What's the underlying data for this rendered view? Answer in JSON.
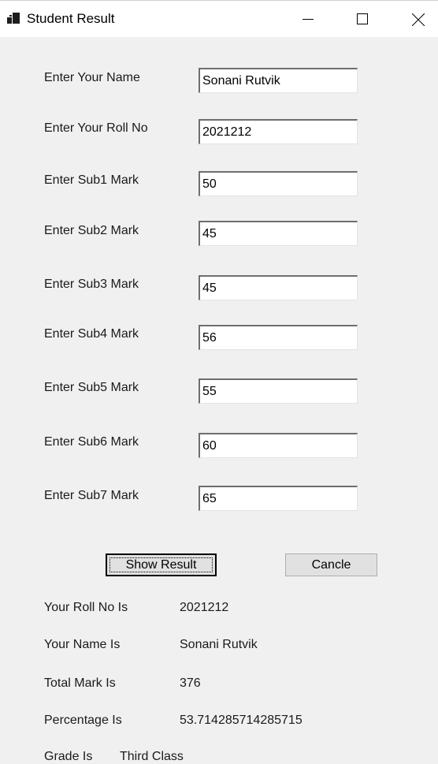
{
  "window": {
    "title": "Student Result"
  },
  "form": {
    "fields": [
      {
        "label": "Enter Your Name",
        "value": "Sonani Rutvik"
      },
      {
        "label": "Enter Your Roll No",
        "value": "2021212"
      },
      {
        "label": "Enter Sub1 Mark",
        "value": "50"
      },
      {
        "label": "Enter Sub2 Mark",
        "value": "45"
      },
      {
        "label": "Enter Sub3 Mark",
        "value": "45"
      },
      {
        "label": "Enter Sub4 Mark",
        "value": "56"
      },
      {
        "label": "Enter Sub5 Mark",
        "value": "55"
      },
      {
        "label": "Enter Sub6 Mark",
        "value": "60"
      },
      {
        "label": "Enter Sub7 Mark",
        "value": "65"
      }
    ]
  },
  "buttons": {
    "show_result": "Show Result",
    "cancel": "Cancle"
  },
  "results": {
    "roll_label": "Your Roll No Is",
    "roll_value": "2021212",
    "name_label": "Your Name Is",
    "name_value": "Sonani Rutvik",
    "total_label": "Total Mark Is",
    "total_value": "376",
    "percentage_label": "Percentage Is",
    "percentage_value": "53.714285714285715",
    "grade_label": "Grade Is",
    "grade_value": "Third Class"
  },
  "icons": {
    "app": "app-window-icon",
    "minimize": "minimize-icon",
    "maximize": "maximize-icon",
    "close": "close-icon"
  }
}
